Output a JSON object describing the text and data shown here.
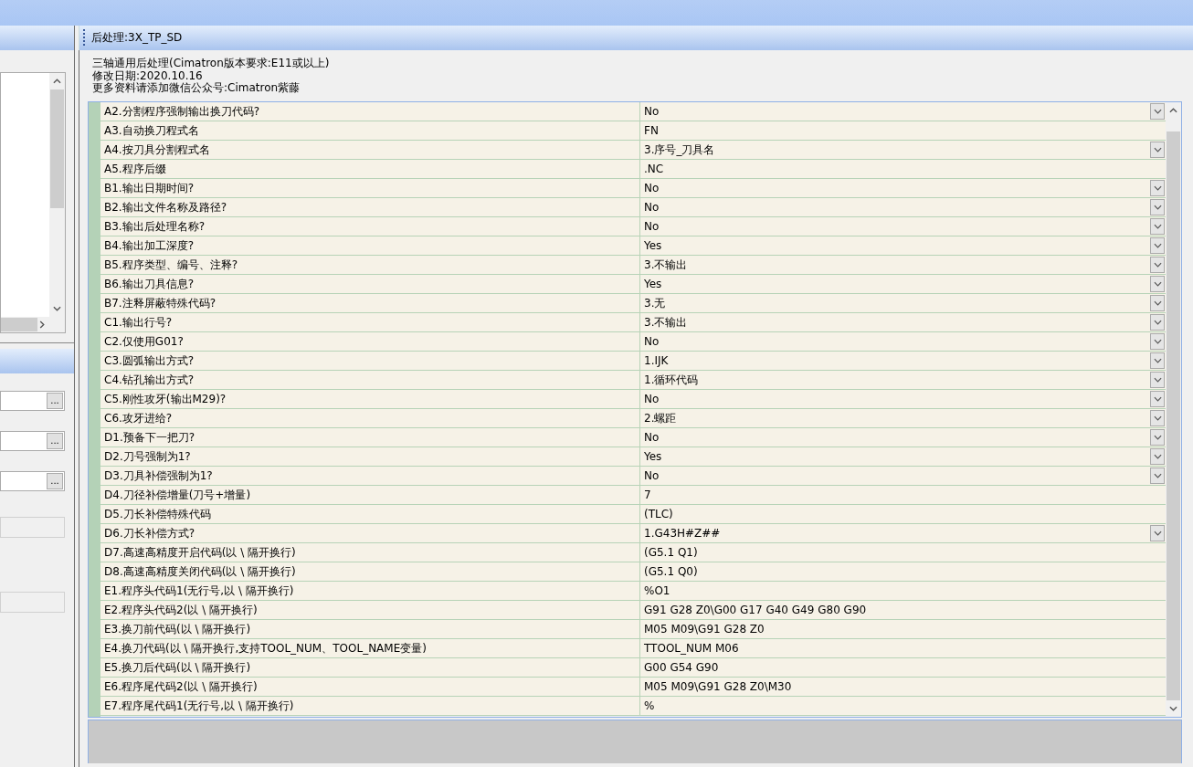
{
  "panel": {
    "title": "后处理:3X_TP_SD"
  },
  "info": [
    "三轴通用后处理(Cimatron版本要求:E11或以上)",
    "修改日期:2020.10.16",
    "更多资料请添加微信公众号:Cimatron紫藤"
  ],
  "left_fields": [
    {
      "button": "..."
    },
    {
      "button": "..."
    },
    {
      "button": "..."
    }
  ],
  "grid": {
    "rows": [
      {
        "label": "A2.分割程序强制输出换刀代码?",
        "value": "No",
        "kind": "dropdown"
      },
      {
        "label": "A3.自动换刀程式名",
        "value": "FN",
        "kind": "text"
      },
      {
        "label": "A4.按刀具分割程式名",
        "value": "3.序号_刀具名",
        "kind": "dropdown"
      },
      {
        "label": "A5.程序后缀",
        "value": ".NC",
        "kind": "text"
      },
      {
        "label": "B1.输出日期时间?",
        "value": "No",
        "kind": "dropdown"
      },
      {
        "label": "B2.输出文件名称及路径?",
        "value": "No",
        "kind": "dropdown"
      },
      {
        "label": "B3.输出后处理名称?",
        "value": "No",
        "kind": "dropdown"
      },
      {
        "label": "B4.输出加工深度?",
        "value": "Yes",
        "kind": "dropdown"
      },
      {
        "label": "B5.程序类型、编号、注释?",
        "value": "3.不输出",
        "kind": "dropdown"
      },
      {
        "label": "B6.输出刀具信息?",
        "value": "Yes",
        "kind": "dropdown"
      },
      {
        "label": "B7.注释屏蔽特殊代码?",
        "value": "3.无",
        "kind": "dropdown"
      },
      {
        "label": "C1.输出行号?",
        "value": "3.不输出",
        "kind": "dropdown"
      },
      {
        "label": "C2.仅使用G01?",
        "value": "No",
        "kind": "dropdown"
      },
      {
        "label": "C3.圆弧输出方式?",
        "value": "1.IJK",
        "kind": "dropdown"
      },
      {
        "label": "C4.钻孔输出方式?",
        "value": "1.循环代码",
        "kind": "dropdown"
      },
      {
        "label": "C5.刚性攻牙(输出M29)?",
        "value": "No",
        "kind": "dropdown"
      },
      {
        "label": "C6.攻牙进给?",
        "value": "2.螺距",
        "kind": "dropdown"
      },
      {
        "label": "D1.预备下一把刀?",
        "value": "No",
        "kind": "dropdown"
      },
      {
        "label": "D2.刀号强制为1?",
        "value": "Yes",
        "kind": "dropdown"
      },
      {
        "label": "D3.刀具补偿强制为1?",
        "value": "No",
        "kind": "dropdown"
      },
      {
        "label": "D4.刀径补偿增量(刀号+增量)",
        "value": "7",
        "kind": "text"
      },
      {
        "label": "D5.刀长补偿特殊代码",
        "value": "(TLC)",
        "kind": "text"
      },
      {
        "label": "D6.刀长补偿方式?",
        "value": "1.G43H#Z##",
        "kind": "dropdown"
      },
      {
        "label": "D7.高速高精度开启代码(以 \\ 隔开换行)",
        "value": "(G5.1 Q1)",
        "kind": "text"
      },
      {
        "label": "D8.高速高精度关闭代码(以 \\ 隔开换行)",
        "value": "(G5.1 Q0)",
        "kind": "text"
      },
      {
        "label": "E1.程序头代码1(无行号,以 \\ 隔开换行)",
        "value": "%O1",
        "kind": "text"
      },
      {
        "label": "E2.程序头代码2(以 \\ 隔开换行)",
        "value": "G91 G28 Z0\\G00 G17 G40 G49 G80 G90",
        "kind": "text"
      },
      {
        "label": "E3.换刀前代码(以 \\ 隔开换行)",
        "value": "M05 M09\\G91 G28 Z0",
        "kind": "text"
      },
      {
        "label": "E4.换刀代码(以 \\ 隔开换行,支持TOOL_NUM、TOOL_NAME变量)",
        "value": "TTOOL_NUM M06",
        "kind": "text"
      },
      {
        "label": "E5.换刀后代码(以 \\ 隔开换行)",
        "value": "G00 G54 G90",
        "kind": "text"
      },
      {
        "label": "E6.程序尾代码2(以 \\ 隔开换行)",
        "value": "M05 M09\\G91 G28 Z0\\M30",
        "kind": "text"
      },
      {
        "label": "E7.程序尾代码1(无行号,以 \\ 隔开换行)",
        "value": "%",
        "kind": "text"
      }
    ]
  }
}
